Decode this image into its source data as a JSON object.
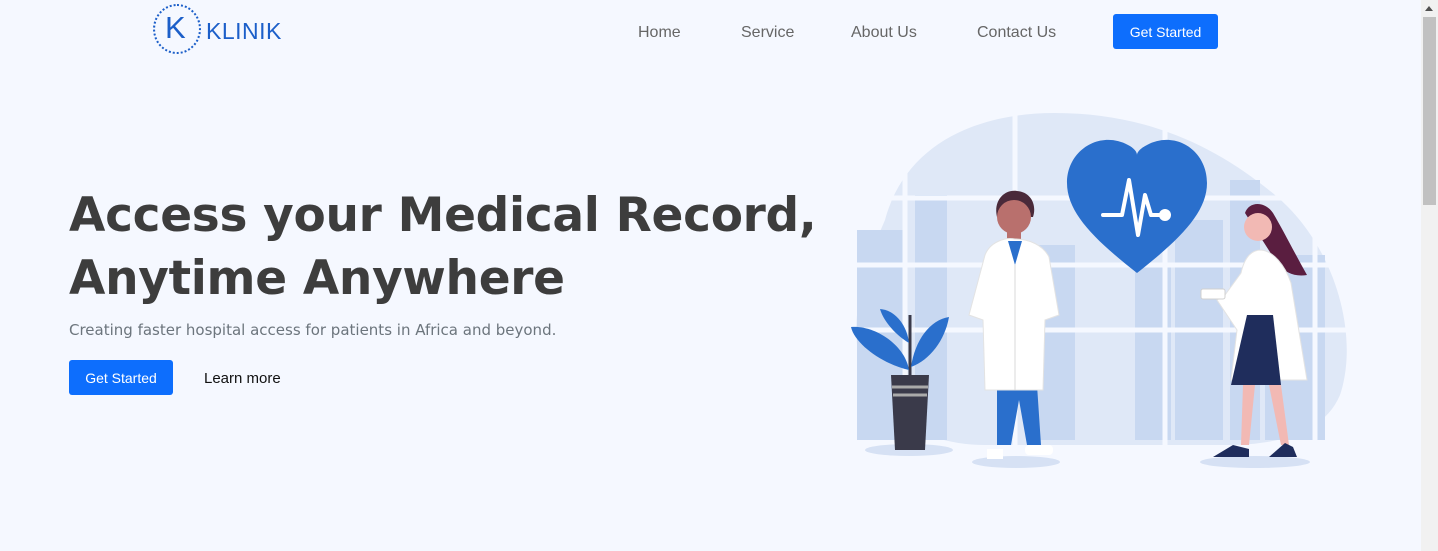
{
  "brand": {
    "logo_letter": "K",
    "name": "KLINIK",
    "color": "#1c5fc9"
  },
  "nav": {
    "links": [
      "Home",
      "Service",
      "About Us",
      "Contact Us"
    ],
    "cta_label": "Get Started"
  },
  "hero": {
    "title_line1": "Access your Medical Record,",
    "title_line2": "Anytime Anywhere",
    "subtitle": "Creating faster hospital access for patients in Africa and beyond.",
    "primary_cta": "Get Started",
    "secondary_cta": "Learn more"
  },
  "illustration": {
    "icon": "doctors-heart-illustration"
  },
  "colors": {
    "accent": "#0d6efd",
    "background": "#f5f8ff",
    "heading": "#3d3d3d"
  }
}
